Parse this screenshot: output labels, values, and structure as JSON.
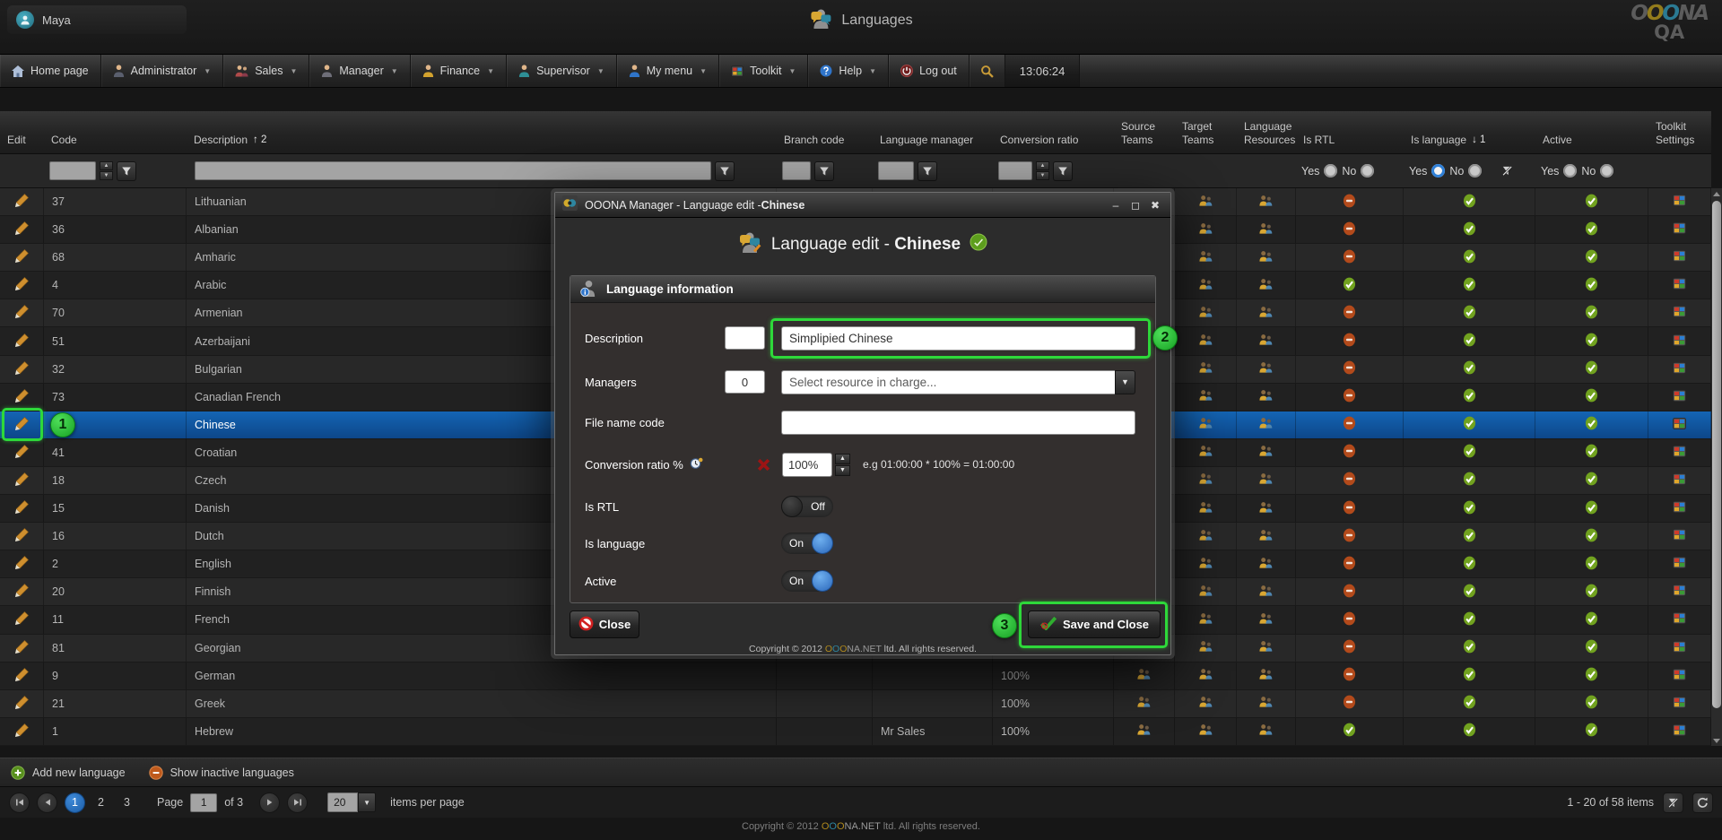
{
  "header": {
    "user": "Maya",
    "title": "Languages",
    "logo_line1": "OOONA",
    "logo_line2": "QA"
  },
  "menu": {
    "items": [
      {
        "label": "Home page",
        "icon": "home",
        "caret": false
      },
      {
        "label": "Administrator",
        "icon": "person-admin",
        "caret": true
      },
      {
        "label": "Sales",
        "icon": "person-sales",
        "caret": true
      },
      {
        "label": "Manager",
        "icon": "person-manager",
        "caret": true
      },
      {
        "label": "Finance",
        "icon": "person-finance",
        "caret": true
      },
      {
        "label": "Supervisor",
        "icon": "person-supervisor",
        "caret": true
      },
      {
        "label": "My menu",
        "icon": "person-mymenu",
        "caret": true
      },
      {
        "label": "Toolkit",
        "icon": "toolkit",
        "caret": true
      },
      {
        "label": "Help",
        "icon": "help",
        "caret": true
      },
      {
        "label": "Log out",
        "icon": "logout",
        "caret": false
      }
    ],
    "time": "13:06:24"
  },
  "table": {
    "columns": [
      {
        "id": "edit",
        "label": "Edit"
      },
      {
        "id": "code",
        "label": "Code"
      },
      {
        "id": "description",
        "label": "Description",
        "sort_dir": "up",
        "sort_num": "2"
      },
      {
        "id": "branch",
        "label": "Branch code"
      },
      {
        "id": "langmgr",
        "label": "Language manager"
      },
      {
        "id": "conv",
        "label": "Conversion ratio"
      },
      {
        "id": "source",
        "label": "Source\nTeams"
      },
      {
        "id": "target",
        "label": "Target\nTeams"
      },
      {
        "id": "langres",
        "label": "Language\nResources"
      },
      {
        "id": "isrtl",
        "label": "Is RTL"
      },
      {
        "id": "islang",
        "label": "Is language",
        "sort_dir": "down",
        "sort_num": "1"
      },
      {
        "id": "active",
        "label": "Active"
      },
      {
        "id": "toolkit",
        "label": "Toolkit\nSettings"
      }
    ],
    "filters": {
      "code": "",
      "description": "",
      "branch": "",
      "langmgr": "",
      "conv": "",
      "isrtl": {
        "yes": "Yes",
        "no": "No",
        "value": null
      },
      "islang": {
        "yes": "Yes",
        "no": "No",
        "value": "yes"
      },
      "active": {
        "yes": "Yes",
        "no": "No",
        "value": null
      }
    },
    "rows": [
      {
        "code": "37",
        "description": "Lithuanian",
        "branch": "",
        "langmgr": "",
        "conv": "",
        "rtl": "no",
        "islang": true,
        "active": true,
        "selected": false
      },
      {
        "code": "36",
        "description": "Albanian",
        "branch": "",
        "langmgr": "",
        "conv": "",
        "rtl": "no",
        "islang": true,
        "active": true,
        "selected": false
      },
      {
        "code": "68",
        "description": "Amharic",
        "branch": "",
        "langmgr": "",
        "conv": "",
        "rtl": "no",
        "islang": true,
        "active": true,
        "selected": false
      },
      {
        "code": "4",
        "description": "Arabic",
        "branch": "",
        "langmgr": "",
        "conv": "",
        "rtl": "yes",
        "islang": true,
        "active": true,
        "selected": false
      },
      {
        "code": "70",
        "description": "Armenian",
        "branch": "",
        "langmgr": "",
        "conv": "",
        "rtl": "no",
        "islang": true,
        "active": true,
        "selected": false
      },
      {
        "code": "51",
        "description": "Azerbaijani",
        "branch": "",
        "langmgr": "",
        "conv": "",
        "rtl": "no",
        "islang": true,
        "active": true,
        "selected": false
      },
      {
        "code": "32",
        "description": "Bulgarian",
        "branch": "",
        "langmgr": "",
        "conv": "",
        "rtl": "no",
        "islang": true,
        "active": true,
        "selected": false
      },
      {
        "code": "73",
        "description": "Canadian French",
        "branch": "",
        "langmgr": "",
        "conv": "",
        "rtl": "no",
        "islang": true,
        "active": true,
        "selected": false
      },
      {
        "code": "",
        "description": "Chinese",
        "branch": "",
        "langmgr": "",
        "conv": "",
        "rtl": "no",
        "islang": true,
        "active": true,
        "selected": true
      },
      {
        "code": "41",
        "description": "Croatian",
        "branch": "",
        "langmgr": "",
        "conv": "",
        "rtl": "no",
        "islang": true,
        "active": true,
        "selected": false
      },
      {
        "code": "18",
        "description": "Czech",
        "branch": "",
        "langmgr": "",
        "conv": "",
        "rtl": "no",
        "islang": true,
        "active": true,
        "selected": false
      },
      {
        "code": "15",
        "description": "Danish",
        "branch": "",
        "langmgr": "",
        "conv": "",
        "rtl": "no",
        "islang": true,
        "active": true,
        "selected": false
      },
      {
        "code": "16",
        "description": "Dutch",
        "branch": "",
        "langmgr": "",
        "conv": "",
        "rtl": "no",
        "islang": true,
        "active": true,
        "selected": false
      },
      {
        "code": "2",
        "description": "English",
        "branch": "",
        "langmgr": "",
        "conv": "",
        "rtl": "no",
        "islang": true,
        "active": true,
        "selected": false
      },
      {
        "code": "20",
        "description": "Finnish",
        "branch": "",
        "langmgr": "",
        "conv": "",
        "rtl": "no",
        "islang": true,
        "active": true,
        "selected": false
      },
      {
        "code": "11",
        "description": "French",
        "branch": "",
        "langmgr": "",
        "conv": "",
        "rtl": "no",
        "islang": true,
        "active": true,
        "selected": false
      },
      {
        "code": "81",
        "description": "Georgian",
        "branch": "",
        "langmgr": "",
        "conv": "",
        "rtl": "no",
        "islang": true,
        "active": true,
        "selected": false
      },
      {
        "code": "9",
        "description": "German",
        "branch": "",
        "langmgr": "",
        "conv": "100%",
        "rtl": "no",
        "islang": true,
        "active": true,
        "selected": false
      },
      {
        "code": "21",
        "description": "Greek",
        "branch": "",
        "langmgr": "",
        "conv": "100%",
        "rtl": "no",
        "islang": true,
        "active": true,
        "selected": false
      },
      {
        "code": "1",
        "description": "Hebrew",
        "branch": "",
        "langmgr": "Mr Sales",
        "conv": "100%",
        "rtl": "yes",
        "islang": true,
        "active": true,
        "selected": false
      }
    ]
  },
  "modal": {
    "titlebar_prefix": "OOONA Manager - Language edit -",
    "titlebar_bold": "Chinese",
    "title_prefix": "Language edit - ",
    "title_bold": "Chinese",
    "section_title": "Language information",
    "fields": {
      "description": {
        "label": "Description",
        "code_value": "",
        "value": "Simplipied Chinese"
      },
      "managers": {
        "label": "Managers",
        "count": "0",
        "placeholder": "Select resource in charge..."
      },
      "file_name_code": {
        "label": "File name code",
        "value": ""
      },
      "conversion": {
        "label": "Conversion ratio %",
        "value": "100%",
        "hint": "e.g 01:00:00 * 100% = 01:00:00"
      },
      "is_rtl": {
        "label": "Is RTL",
        "state": "Off"
      },
      "is_language": {
        "label": "Is language",
        "state": "On"
      },
      "active": {
        "label": "Active",
        "state": "On"
      }
    },
    "buttons": {
      "close": "Close",
      "save": "Save and Close"
    }
  },
  "footer": {
    "add_new": "Add new language",
    "show_inactive": "Show inactive languages",
    "pagination": {
      "pages": [
        "1",
        "2",
        "3"
      ],
      "current": "1",
      "page_label": "Page",
      "page_value": "1",
      "of_label": "of 3",
      "per_page_value": "20",
      "per_page_label": "items per page",
      "items_info": "1 - 20 of 58 items"
    }
  },
  "copyright": {
    "prefix": "Copyright © 2012 ",
    "brand": "OOONA.NET",
    "suffix": " ltd. All rights reserved."
  },
  "annotations": {
    "m1": "1",
    "m2": "2",
    "m3": "3"
  }
}
